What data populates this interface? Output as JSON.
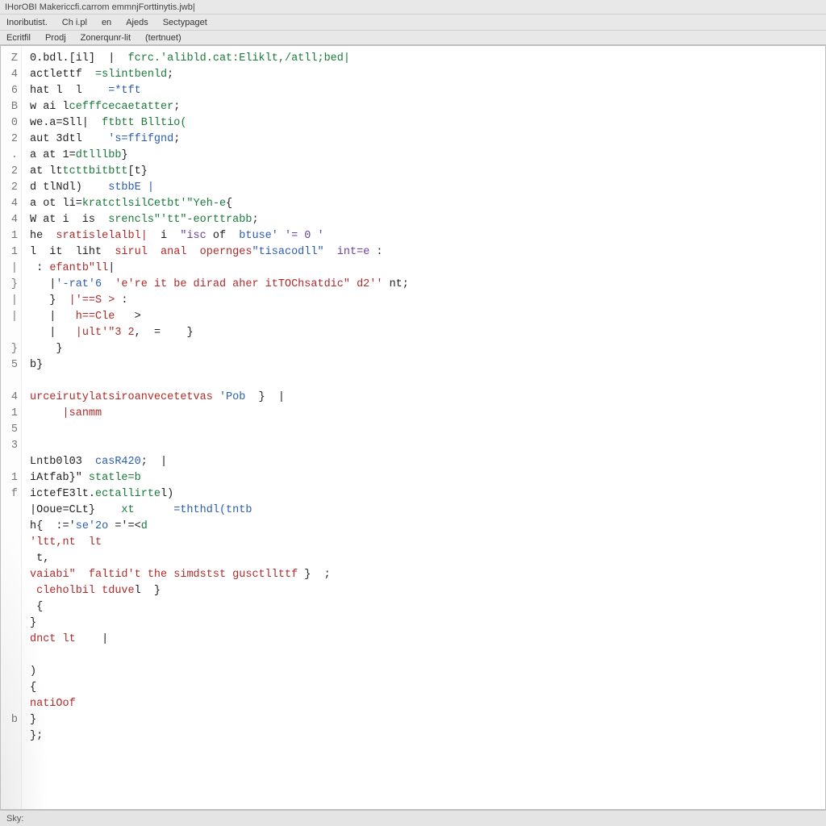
{
  "window": {
    "title": "IHorOBI Makericcfi.carrom emmnjForttinytis.jwb|"
  },
  "menu1": {
    "items": [
      "Inoributist.",
      "Ch i.pl",
      "en",
      "Ajeds",
      "Sectypaget"
    ]
  },
  "menu2": {
    "items": [
      "Ecritfil",
      "Prodj",
      "Zonerqunr-lit",
      "(tertnuet)"
    ]
  },
  "gutter": [
    "Z",
    "4",
    "6",
    "B",
    "0",
    "2",
    ".",
    "2",
    "2",
    "4",
    "4",
    "1",
    "1",
    "|",
    "}",
    "|",
    "|",
    "",
    "}",
    "5",
    "",
    "4",
    "1",
    "5",
    "3",
    "",
    "1",
    "f",
    "",
    "",
    "",
    "",
    "",
    "",
    "",
    "",
    "",
    "",
    "",
    "",
    "",
    "b"
  ],
  "lines": [
    {
      "segs": [
        {
          "t": "0.bdl.[il]  |  ",
          "c": ""
        },
        {
          "t": "fcrc.'alibld.cat:Eliklt,/atll;bed|",
          "c": "fn"
        }
      ]
    },
    {
      "segs": [
        {
          "t": "actlettf  ",
          "c": ""
        },
        {
          "t": "=slintbenld",
          "c": "fn"
        },
        {
          "t": ";",
          "c": ""
        }
      ]
    },
    {
      "segs": [
        {
          "t": "hat l  l    ",
          "c": ""
        },
        {
          "t": "=*tft",
          "c": "num"
        }
      ]
    },
    {
      "segs": [
        {
          "t": "w ai l",
          "c": ""
        },
        {
          "t": "cefffcecaetatter",
          "c": "fn"
        },
        {
          "t": ";",
          "c": ""
        }
      ]
    },
    {
      "segs": [
        {
          "t": "we.a=Sll|  ",
          "c": ""
        },
        {
          "t": "ftbtt Blltio(",
          "c": "fn"
        }
      ]
    },
    {
      "segs": [
        {
          "t": "aut 3dtl    ",
          "c": ""
        },
        {
          "t": "'s=ffifgnd",
          "c": "num"
        },
        {
          "t": ";",
          "c": ""
        }
      ]
    },
    {
      "segs": [
        {
          "t": "a at 1=",
          "c": ""
        },
        {
          "t": "dtlllbb",
          "c": "fn"
        },
        {
          "t": "}",
          "c": ""
        }
      ]
    },
    {
      "segs": [
        {
          "t": "at lt",
          "c": ""
        },
        {
          "t": "tcttbitbtt",
          "c": "fn"
        },
        {
          "t": "[t}",
          "c": ""
        }
      ]
    },
    {
      "segs": [
        {
          "t": "d tlNdl)    ",
          "c": ""
        },
        {
          "t": "stbbE |",
          "c": "num"
        }
      ]
    },
    {
      "segs": [
        {
          "t": "a ot li=",
          "c": ""
        },
        {
          "t": "kratctlsilCetbt'\"Yeh-e",
          "c": "fn"
        },
        {
          "t": "{",
          "c": ""
        }
      ]
    },
    {
      "segs": [
        {
          "t": "W at i  is  ",
          "c": ""
        },
        {
          "t": "srencls\"'tt\"-eorttrabb",
          "c": "fn"
        },
        {
          "t": ";",
          "c": ""
        }
      ]
    },
    {
      "segs": [
        {
          "t": "he  ",
          "c": ""
        },
        {
          "t": "sratislelalbl|",
          "c": "str"
        },
        {
          "t": "  i  ",
          "c": ""
        },
        {
          "t": "\"isc",
          "c": "kw"
        },
        {
          "t": " of  ",
          "c": ""
        },
        {
          "t": "btuse'",
          "c": "num"
        },
        {
          "t": " '= 0 '",
          "c": "kw"
        }
      ]
    },
    {
      "segs": [
        {
          "t": "l  it  liht  ",
          "c": ""
        },
        {
          "t": "sirul  anal  opernges",
          "c": "str"
        },
        {
          "t": "\"tisacodll\"",
          "c": "num"
        },
        {
          "t": "  ",
          "c": ""
        },
        {
          "t": "int=e",
          "c": "kw"
        },
        {
          "t": " :",
          "c": ""
        }
      ]
    },
    {
      "segs": [
        {
          "t": " : ",
          "c": ""
        },
        {
          "t": "efantb\"ll",
          "c": "str"
        },
        {
          "t": "|",
          "c": ""
        }
      ]
    },
    {
      "segs": [
        {
          "t": "   |",
          "c": ""
        },
        {
          "t": "'-rat'6",
          "c": "num"
        },
        {
          "t": "  ",
          "c": ""
        },
        {
          "t": "'e're it be dirad aher itTOChsatdic\" d2''",
          "c": "str"
        },
        {
          "t": " nt;",
          "c": ""
        }
      ]
    },
    {
      "segs": [
        {
          "t": "   }  ",
          "c": ""
        },
        {
          "t": "|'==S >",
          "c": "str"
        },
        {
          "t": " :",
          "c": ""
        }
      ]
    },
    {
      "segs": [
        {
          "t": "   |   ",
          "c": ""
        },
        {
          "t": "h==Cle",
          "c": "str"
        },
        {
          "t": "   >",
          "c": ""
        }
      ]
    },
    {
      "segs": [
        {
          "t": "   |   ",
          "c": ""
        },
        {
          "t": "|ult'\"3 2",
          "c": "str"
        },
        {
          "t": ",  =    }",
          "c": ""
        }
      ]
    },
    {
      "segs": [
        {
          "t": "    }",
          "c": ""
        }
      ]
    },
    {
      "segs": [
        {
          "t": "b}",
          "c": ""
        }
      ]
    },
    {
      "segs": [
        {
          "t": "",
          "c": ""
        }
      ]
    },
    {
      "segs": [
        {
          "t": "urceirutylatsiroanvecetetvas ",
          "c": "str"
        },
        {
          "t": "'Pob",
          "c": "num"
        },
        {
          "t": "  }  |",
          "c": ""
        }
      ]
    },
    {
      "segs": [
        {
          "t": "     ",
          "c": ""
        },
        {
          "t": "|sanmm",
          "c": "str"
        }
      ]
    },
    {
      "segs": [
        {
          "t": "",
          "c": ""
        }
      ]
    },
    {
      "segs": [
        {
          "t": "",
          "c": ""
        }
      ]
    },
    {
      "segs": [
        {
          "t": "Lntb0l03  ",
          "c": ""
        },
        {
          "t": "casR420",
          "c": "num"
        },
        {
          "t": ";  |",
          "c": ""
        }
      ]
    },
    {
      "segs": [
        {
          "t": "iAtfab}\" ",
          "c": ""
        },
        {
          "t": "statle=b",
          "c": "fn"
        }
      ]
    },
    {
      "segs": [
        {
          "t": "ictefE3lt.",
          "c": ""
        },
        {
          "t": "ectallirte",
          "c": "fn"
        },
        {
          "t": "l)",
          "c": ""
        }
      ]
    },
    {
      "segs": [
        {
          "t": "|Ooue=CLt}    ",
          "c": ""
        },
        {
          "t": "xt",
          "c": "fn"
        },
        {
          "t": "      ",
          "c": ""
        },
        {
          "t": "=ththdl(tntb",
          "c": "num"
        }
      ]
    },
    {
      "segs": [
        {
          "t": "h{  :='",
          "c": ""
        },
        {
          "t": "se'2o",
          "c": "num"
        },
        {
          "t": " ='=<",
          "c": ""
        },
        {
          "t": "d",
          "c": "fn"
        }
      ]
    },
    {
      "segs": [
        {
          "t": "'ltt,nt  lt",
          "c": "str"
        }
      ]
    },
    {
      "segs": [
        {
          "t": " t,",
          "c": ""
        }
      ]
    },
    {
      "segs": [
        {
          "t": "vaiabi\"",
          "c": "str"
        },
        {
          "t": "  ",
          "c": ""
        },
        {
          "t": "faltid't the simdstst gusctllttf",
          "c": "str"
        },
        {
          "t": " }  ;",
          "c": ""
        }
      ]
    },
    {
      "segs": [
        {
          "t": " cleholbil tduve",
          "c": "str"
        },
        {
          "t": "l  }",
          "c": ""
        }
      ]
    },
    {
      "segs": [
        {
          "t": " {",
          "c": ""
        }
      ]
    },
    {
      "segs": [
        {
          "t": "}",
          "c": ""
        }
      ]
    },
    {
      "segs": [
        {
          "t": "dnct lt",
          "c": "str"
        },
        {
          "t": "    |",
          "c": ""
        }
      ]
    },
    {
      "segs": [
        {
          "t": "",
          "c": ""
        }
      ]
    },
    {
      "segs": [
        {
          "t": ")",
          "c": ""
        }
      ]
    },
    {
      "segs": [
        {
          "t": "{",
          "c": ""
        }
      ]
    },
    {
      "segs": [
        {
          "t": "natiOof",
          "c": "str"
        }
      ]
    },
    {
      "segs": [
        {
          "t": "}",
          "c": ""
        }
      ]
    },
    {
      "segs": [
        {
          "t": "};",
          "c": ""
        }
      ]
    }
  ],
  "status": {
    "text": "Sky:"
  }
}
